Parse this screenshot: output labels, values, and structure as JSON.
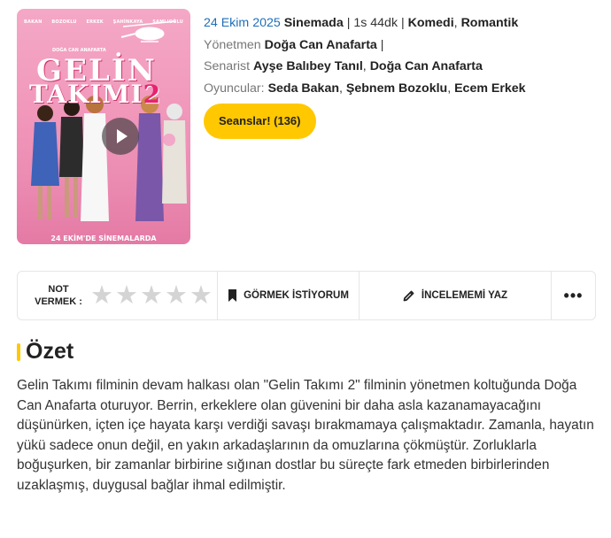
{
  "poster": {
    "cast_names": [
      "BAKAN",
      "BOZOKLU",
      "ERKEK",
      "ŞAHİNKAYA",
      "ŞAMLIOĞLU"
    ],
    "director_text": "DOĞA CAN ANAFARTA",
    "title_line1": "GELİN",
    "title_line2": "TAKIMI",
    "title_number": "2",
    "release_text": "24 EKİM'DE SİNEMALARDA"
  },
  "movie": {
    "date": "24 Ekim 2025",
    "status": "Sinemada",
    "duration": "1s 44dk",
    "genres": [
      "Komedi",
      "Romantik"
    ],
    "director_label": "Yönetmen",
    "director": "Doğa Can Anafarta",
    "writer_label": "Senarist",
    "writers": [
      "Ayşe Balıbey Tanıl",
      "Doğa Can Anafarta"
    ],
    "cast_label": "Oyuncular:",
    "cast": [
      "Seda Bakan",
      "Şebnem Bozoklu",
      "Ecem Erkek"
    ],
    "showtimes_button": "Seanslar! (136)"
  },
  "actions": {
    "rating_label_line1": "NOT",
    "rating_label_line2": "VERMEK :",
    "stars_count": 5,
    "rating_value": 0,
    "watchlist_label": "GÖRMEK İSTİYORUM",
    "review_label": "İNCELEMEMİ YAZ",
    "more_label": "•••"
  },
  "summary": {
    "title": "Özet",
    "text": "Gelin Takımı filminin devam halkası olan \"Gelin Takımı 2\" filminin yönetmen koltuğunda Doğa Can Anafarta oturuyor. Berrin, erkeklere olan güvenini bir daha asla kazanamayacağını düşünürken, içten içe hayata karşı verdiği savaşı bırakmamaya çalışmaktadır. Zamanla, hayatın yükü sadece onun değil, en yakın arkadaşlarının da omuzlarına çökmüştür. Zorluklarla boğuşurken, bir zamanlar birbirine sığınan dostlar bu süreçte fark etmeden birbirlerinden uzaklaşmış, duygusal bağlar ihmal edilmiştir."
  },
  "colors": {
    "accent": "#ffc800",
    "date_link": "#1e6fb8",
    "star_empty": "#d4d4d4",
    "poster_pink": "#f29bbd"
  }
}
